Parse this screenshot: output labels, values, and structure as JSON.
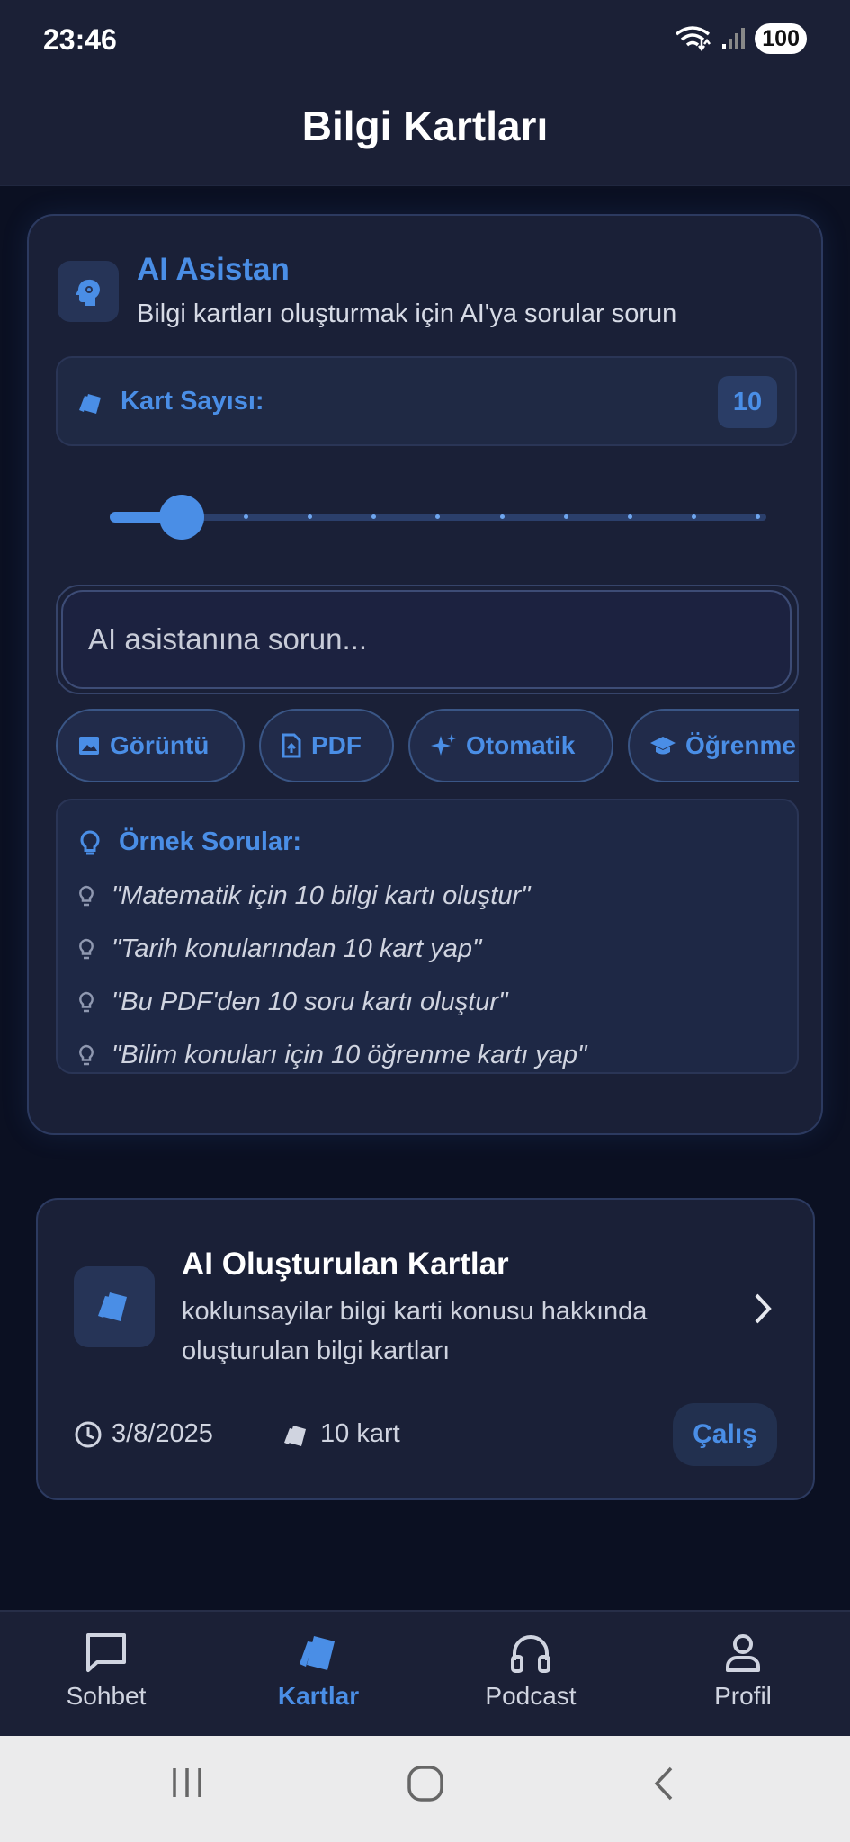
{
  "status_bar": {
    "time": "23:46",
    "battery": "100"
  },
  "header": {
    "title": "Bilgi Kartları"
  },
  "ai_assistant": {
    "title": "AI Asistan",
    "subtitle": "Bilgi kartları oluşturmak için AI'ya sorular sorun",
    "card_count_label": "Kart Sayısı:",
    "card_count_value": "10",
    "slider": {
      "value": 10,
      "min": 10,
      "max": 100,
      "steps": 10
    },
    "input_placeholder": "AI asistanına sorun...",
    "chips": [
      {
        "label": "Görüntü",
        "icon": "image-icon"
      },
      {
        "label": "PDF",
        "icon": "file-upload-icon"
      },
      {
        "label": "Otomatik",
        "icon": "sparkle-icon"
      },
      {
        "label": "Öğrenme",
        "icon": "graduation-cap-icon"
      }
    ],
    "examples_title": "Örnek Sorular:",
    "examples": [
      "\"Matematik için 10 bilgi kartı oluştur\"",
      "\"Tarih konularından 10 kart yap\"",
      "\"Bu PDF'den 10 soru kartı oluştur\"",
      "\"Bilim konuları için 10 öğrenme kartı yap\""
    ]
  },
  "generated_cards": {
    "title": "AI Oluşturulan Kartlar",
    "description": "koklunsayilar bilgi karti konusu hakkında oluşturulan bilgi kartları",
    "date": "3/8/2025",
    "count": "10 kart",
    "study_label": "Çalış"
  },
  "bottom_nav": {
    "items": [
      {
        "label": "Sohbet",
        "icon": "chat-icon",
        "active": false
      },
      {
        "label": "Kartlar",
        "icon": "cards-icon",
        "active": true
      },
      {
        "label": "Podcast",
        "icon": "headphones-icon",
        "active": false
      },
      {
        "label": "Profil",
        "icon": "profile-icon",
        "active": false
      }
    ]
  },
  "colors": {
    "accent": "#4a8ee6",
    "background": "#0b1022",
    "surface": "#1a2037",
    "bar": "#1b2036"
  }
}
